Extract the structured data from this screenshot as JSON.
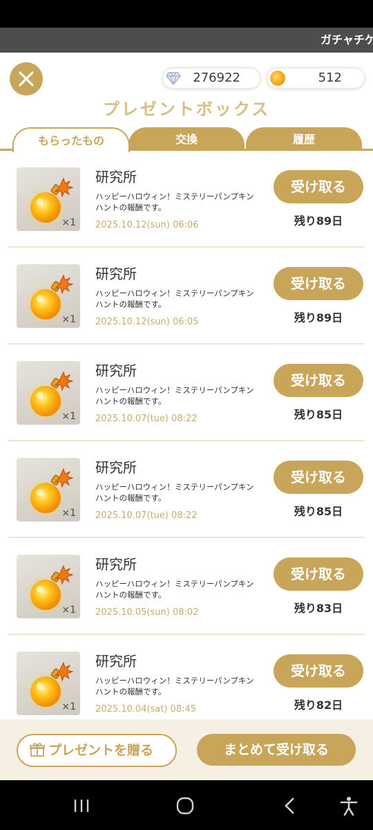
{
  "marquee": {
    "text": "ガチャチケ"
  },
  "currency": {
    "diamond": {
      "icon": "diamond-icon",
      "value": "276922"
    },
    "coin": {
      "icon": "coin-icon",
      "value": "512"
    }
  },
  "title": "プレゼントボックス",
  "tabs": [
    {
      "label": "もらったもの",
      "active": true
    },
    {
      "label": "交換",
      "active": false
    },
    {
      "label": "履歴",
      "active": false
    }
  ],
  "items": [
    {
      "name": "研究所",
      "description": "ハッピーハロウィン！ミステリーパンプキンハントの報酬です。",
      "date": "2025.10.12(sun) 06:06",
      "quantity": "×1",
      "button": "受け取る",
      "remaining": "残り89日"
    },
    {
      "name": "研究所",
      "description": "ハッピーハロウィン！ミステリーパンプキンハントの報酬です。",
      "date": "2025.10.12(sun) 06:05",
      "quantity": "×1",
      "button": "受け取る",
      "remaining": "残り89日"
    },
    {
      "name": "研究所",
      "description": "ハッピーハロウィン！ミステリーパンプキンハントの報酬です。",
      "date": "2025.10.07(tue) 08:22",
      "quantity": "×1",
      "button": "受け取る",
      "remaining": "残り85日"
    },
    {
      "name": "研究所",
      "description": "ハッピーハロウィン！ミステリーパンプキンハントの報酬です。",
      "date": "2025.10.07(tue) 08:22",
      "quantity": "×1",
      "button": "受け取る",
      "remaining": "残り85日"
    },
    {
      "name": "研究所",
      "description": "ハッピーハロウィン！ミステリーパンプキンハントの報酬です。",
      "date": "2025.10.05(sun) 08:02",
      "quantity": "×1",
      "button": "受け取る",
      "remaining": "残り83日"
    },
    {
      "name": "研究所",
      "description": "ハッピーハロウィン！ミステリーパンプキンハントの報酬です。",
      "date": "2025.10.04(sat) 08:45",
      "quantity": "×1",
      "button": "受け取る",
      "remaining": "残り82日"
    }
  ],
  "footer": {
    "gift_label": "プレゼントを贈る",
    "receive_all_label": "まとめて受け取る"
  },
  "colors": {
    "accent": "#c9a55a",
    "title": "#d7bd84",
    "date": "#c9ab6a",
    "footer_bg": "#f5efe4"
  }
}
